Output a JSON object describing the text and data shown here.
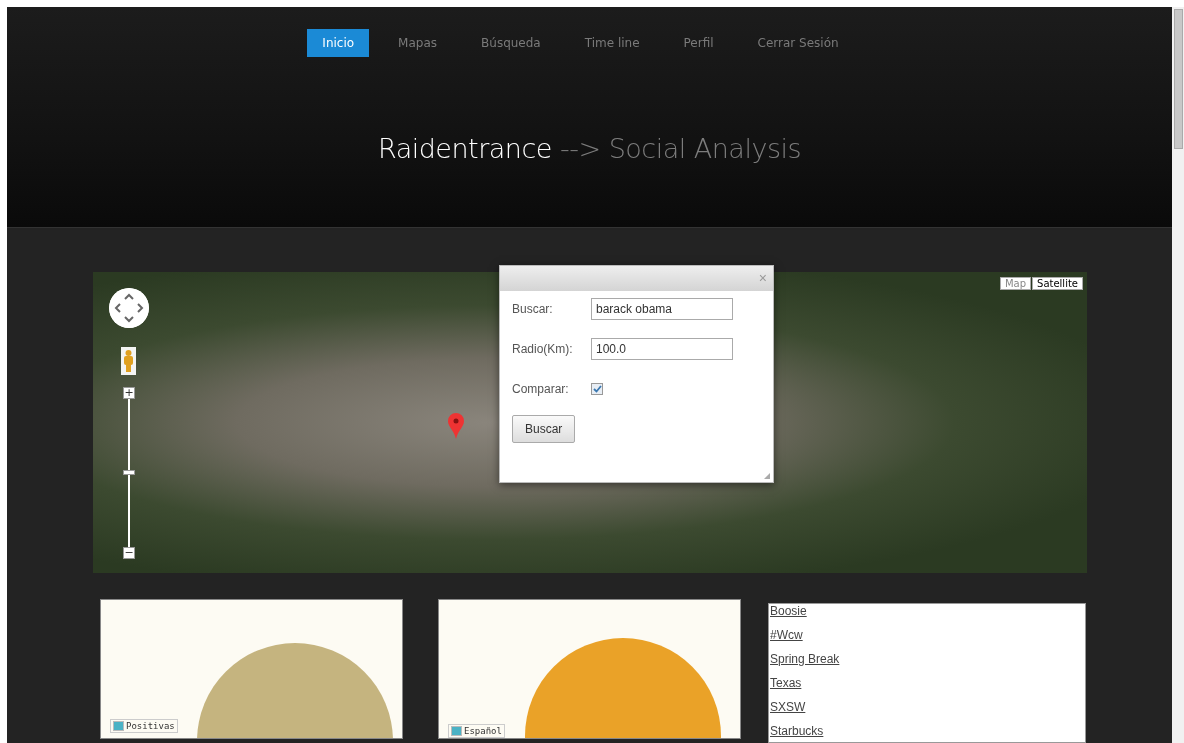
{
  "nav": [
    {
      "label": "Inicio",
      "selected": true
    },
    {
      "label": "Mapas",
      "selected": false
    },
    {
      "label": "Búsqueda",
      "selected": false
    },
    {
      "label": "Time line",
      "selected": false
    },
    {
      "label": "Perfil",
      "selected": false
    },
    {
      "label": "Cerrar Sesión",
      "selected": false
    }
  ],
  "title": {
    "brand": "Raidentrance",
    "rest": "--> Social Analysis"
  },
  "map": {
    "type_buttons": [
      {
        "label": "Map",
        "selected": false
      },
      {
        "label": "Satellite",
        "selected": true
      }
    ],
    "zoom_in": "+",
    "zoom_out": "−",
    "zoom": {
      "level": 0.5
    }
  },
  "dialog": {
    "close": "×",
    "fields": [
      {
        "label": "Buscar:",
        "value": "barack obama"
      },
      {
        "label": "Radio(Km):",
        "value": "100.0"
      }
    ],
    "checkbox": {
      "label": "Comparar:",
      "checked": true
    },
    "button": "Buscar"
  },
  "charts": [
    {
      "color": "#c5b47f",
      "legend": [
        {
          "label": "Positivas",
          "color": "#4bb2c5"
        }
      ]
    },
    {
      "color": "#eaa228",
      "legend": [
        {
          "label": "Español",
          "color": "#4bb2c5"
        }
      ]
    }
  ],
  "trends": [
    "Boosie",
    "#Wcw",
    "Spring Break",
    "Texas",
    "SXSW",
    "Starbucks"
  ]
}
